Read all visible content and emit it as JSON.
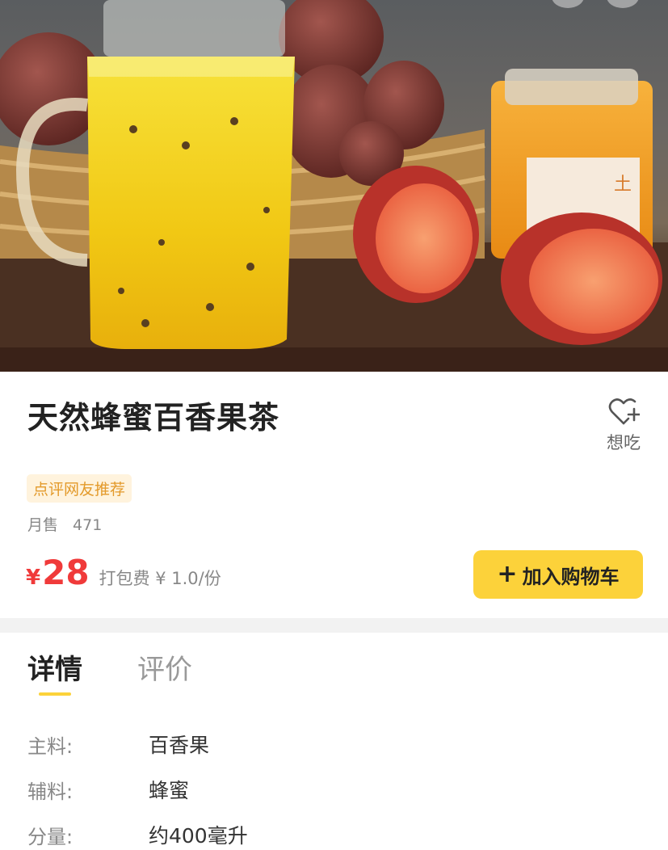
{
  "product": {
    "name": "天然蜂蜜百香果茶",
    "badge": "点评网友推荐",
    "monthly_sales_label": "月售",
    "monthly_sales_value": "471",
    "price_symbol": "¥",
    "price_value": "28",
    "packaging_fee": "打包费 ¥ 1.0/份"
  },
  "want_to_eat": {
    "label": "想吃",
    "icon": "heart-plus-icon"
  },
  "actions": {
    "add_to_cart_label": "加入购物车",
    "add_to_cart_icon": "plus-icon"
  },
  "tabs": [
    {
      "label": "详情",
      "active": true
    },
    {
      "label": "评价",
      "active": false
    }
  ],
  "details": [
    {
      "key": "主料:",
      "value": "百香果"
    },
    {
      "key": "辅料:",
      "value": "蜂蜜"
    },
    {
      "key": "分量:",
      "value": "约400毫升"
    }
  ],
  "colors": {
    "accent_yellow": "#fcd23a",
    "price_red": "#f03a3a",
    "badge_text": "#e39a2a",
    "badge_bg": "#fff3dd"
  }
}
